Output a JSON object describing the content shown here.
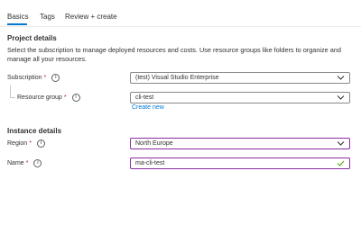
{
  "tabs": [
    {
      "label": "Basics",
      "active": true
    },
    {
      "label": "Tags",
      "active": false
    },
    {
      "label": "Review + create",
      "active": false
    }
  ],
  "project": {
    "title": "Project details",
    "description": "Select the subscription to manage deployed resources and costs. Use resource groups like folders to organize and manage all your resources."
  },
  "subscription": {
    "label": "Subscription",
    "required_mark": "*",
    "value": "(test) Visual Studio Enterprise"
  },
  "resource_group": {
    "label": "Resource group",
    "required_mark": "*",
    "value": "cli-test",
    "create_new": "Create new"
  },
  "instance": {
    "title": "Instance details"
  },
  "region": {
    "label": "Region",
    "required_mark": "*",
    "value": "North Europe"
  },
  "name": {
    "label": "Name",
    "required_mark": "*",
    "value": "ma-cli-test"
  },
  "icons": {
    "info": "info-icon",
    "dropdown": "chevron-down-icon",
    "valid": "checkmark-icon"
  },
  "colors": {
    "accent": "#0078d4",
    "focus_border": "#8a2ba1",
    "required": "#a4262c",
    "valid": "#57a300"
  }
}
